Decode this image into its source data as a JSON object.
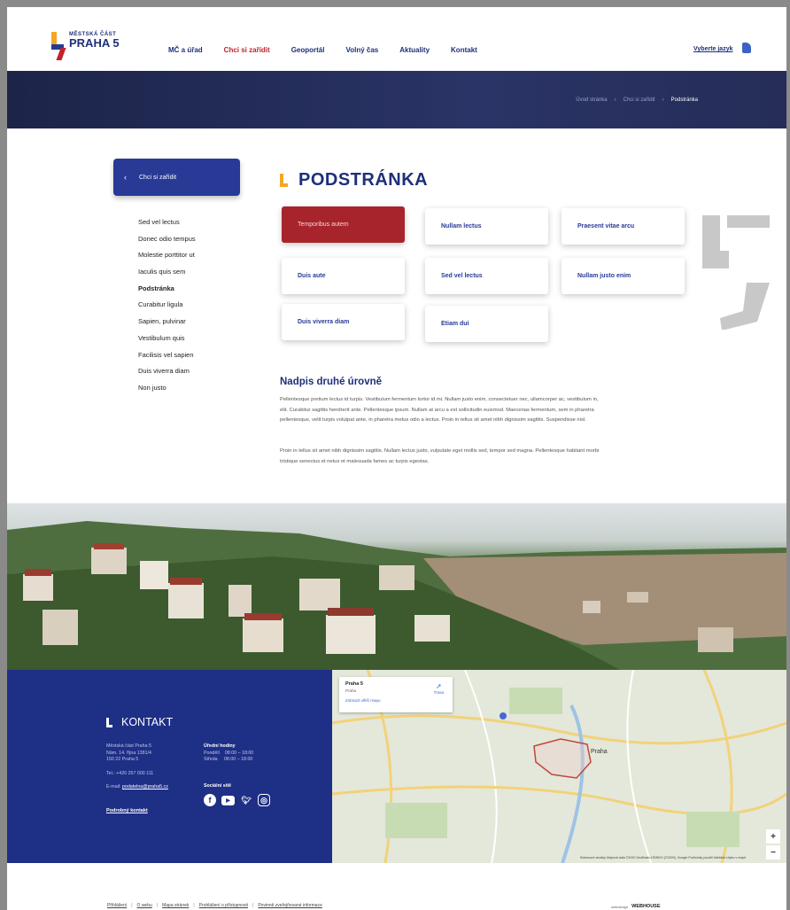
{
  "header": {
    "logo_small": "MĚSTSKÁ ČÁST",
    "logo_big": "PRAHA 5",
    "nav": [
      {
        "label": "MČ a úřad",
        "active": false
      },
      {
        "label": "Chci si zařídit",
        "active": true
      },
      {
        "label": "Geoportál",
        "active": false
      },
      {
        "label": "Volný čas",
        "active": false
      },
      {
        "label": "Aktuality",
        "active": false
      },
      {
        "label": "Kontakt",
        "active": false
      }
    ],
    "lang_label": "Vyberte jazyk",
    "lang_icon": "flag-icon"
  },
  "breadcrumb": [
    "Úvod stránka",
    "Chci si zařídit",
    "Podstránka"
  ],
  "sidebar": {
    "back_label": "Chci si zařídit",
    "items": [
      "Sed vel lectus",
      "Donec odio tempus",
      "Molestie porttitor ut",
      "Iaculis quis sem",
      "Podstránka",
      "Curabitur ligula",
      "Sapien, pulvinar",
      "Vestibulum quis",
      "Facilisis vel sapien",
      "Duis viverra diam",
      "Non justo"
    ],
    "current_index": 4
  },
  "content": {
    "title": "PODSTRÁNKA",
    "tiles": [
      {
        "label": "Temporibus autem",
        "active": true
      },
      {
        "label": "Nullam lectus",
        "active": false
      },
      {
        "label": "Praesent vitae arcu",
        "active": false
      },
      {
        "label": "Duis aute",
        "active": false
      },
      {
        "label": "Sed vel lectus",
        "active": false
      },
      {
        "label": "Nullam justo enim",
        "active": false
      },
      {
        "label": "Duis viverra diam",
        "active": false
      },
      {
        "label": "Etiam dui",
        "active": false
      }
    ],
    "h2": "Nadpis druhé úrovně",
    "paragraphs": [
      "Pellentesque pretium lectus id turpis. Vestibulum fermentum tortor id mi. Nullam justo enim, consectetuer nec, ullamcorper ac, vestibulum in, elit. Curabitur sagittis hendrerit ante. Pellentesque ipsum. Nullam at arcu a est sollicitudin euismod. Maecenas fermentum, sem in pharetra pellentesque, velit turpis volutpat ante, in pharetra metus odio a lectus. Proin in tellus sit amet nibh dignissim sagittis. Suspendisse nisl.",
      "Proin in tellus sit amet nibh dignissim sagittis. Nullam lectus justo, vulputate eget mollis sed, tempor sed magna. Pellentesque habitant morbi tristique senectus et netus et malesuada fames ac turpis egestas."
    ]
  },
  "contact": {
    "title": "KONTAKT",
    "address": [
      "Městská část Praha 5",
      "Nám. 14. října 1381/4",
      "150 22 Praha 5"
    ],
    "phone": "Tel.: +420 257 000 111",
    "email_prefix": "E-mail: ",
    "email": "podatelna@praha5.cz",
    "hours_title": "Úřední hodiny",
    "hours": [
      "Pondělí    08:00 – 18:00",
      "Středa     08:00 – 18:00"
    ],
    "social_title": "Sociální sítě",
    "detail_link": "Podrobný kontakt",
    "social_icons": [
      "facebook-icon",
      "youtube-icon",
      "twitter-icon",
      "instagram-icon"
    ]
  },
  "map": {
    "place": "Praha 5",
    "place_sub": "Praha",
    "larger_link": "Zobrazit větší mapu",
    "route": "Trasa",
    "city_label": "Praha",
    "zoom_in": "+",
    "zoom_out": "−",
    "footer": "Klávesové zkratky   Mapová data ©2020 GeoBasis-DE/BKG (©2009), Google   Podmínky použití   Nahlásit chybu v mapě"
  },
  "footer": {
    "links": [
      "Přihlášení",
      "O webu",
      "Mapa stránek",
      "Prohlášení o přístupnosti",
      "Povinně zveřejňované informace"
    ],
    "credit_small": "webdesign",
    "credit_big": "WEBHOUSE"
  },
  "colors": {
    "brand_blue": "#1e2f86",
    "brand_red": "#a8242c",
    "brand_orange": "#f5a623",
    "hero_dark": "#1c2448"
  }
}
